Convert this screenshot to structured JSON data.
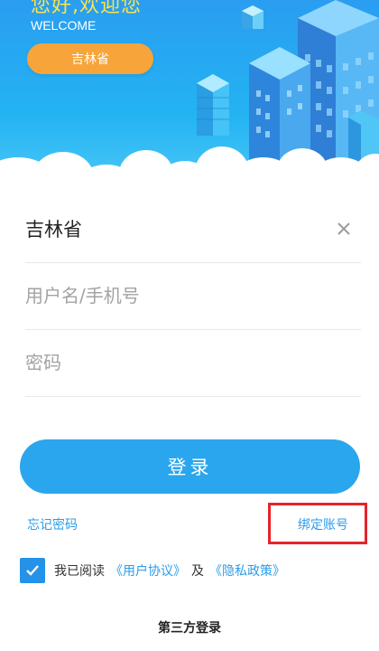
{
  "header": {
    "welcome_cn": "您好,欢迎您",
    "welcome_en": "WELCOME",
    "province_pill": "吉林省"
  },
  "form": {
    "province_value": "吉林省",
    "clear_icon": "close-icon",
    "username_placeholder": "用户名/手机号",
    "password_placeholder": "密码",
    "login_label": "登录",
    "forgot_password": "忘记密码",
    "bind_account": "绑定账号",
    "agree": {
      "checked": true,
      "prefix": "我已阅读",
      "user_agreement": "《用户协议》",
      "and": "及",
      "privacy_policy": "《隐私政策》"
    },
    "third_party_login": "第三方登录"
  },
  "colors": {
    "header_blue": "#23b3f3",
    "accent_orange": "#f7a43a",
    "button_blue": "#2aa6ee",
    "link_blue": "#2a9de9",
    "highlight_red": "#e6232a"
  }
}
